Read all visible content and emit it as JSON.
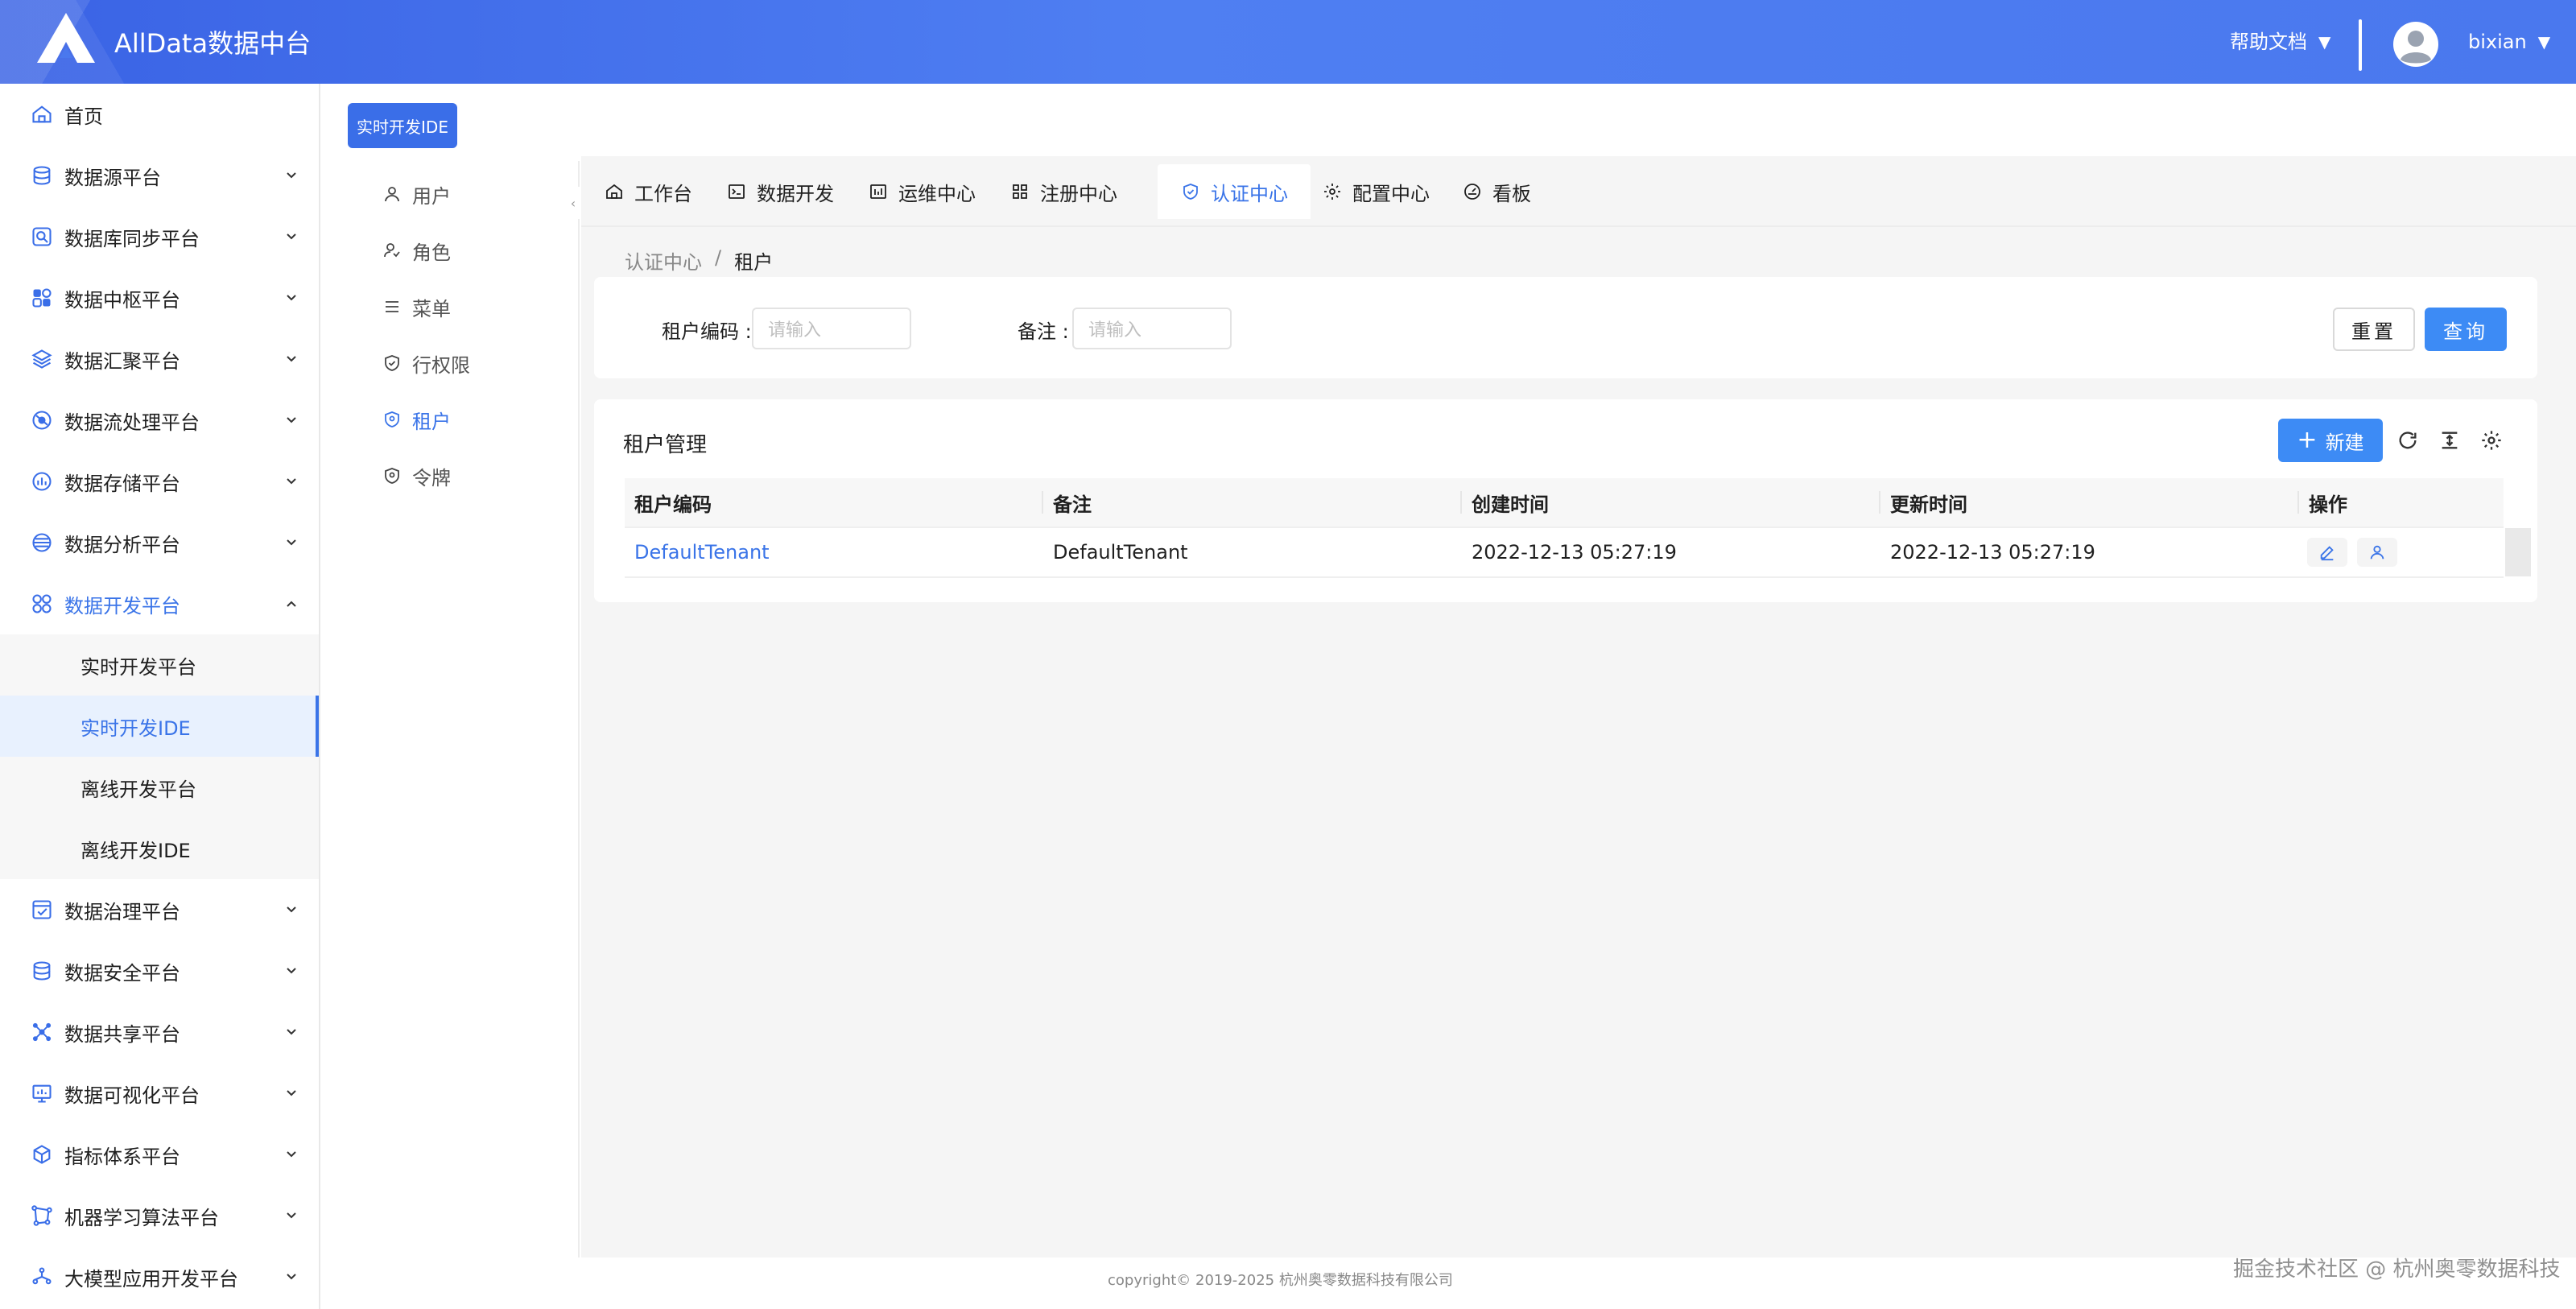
{
  "header": {
    "title": "AllData数据中台",
    "help": "帮助文档",
    "username": "bixian",
    "caret": "▼"
  },
  "sidebar": {
    "items": [
      {
        "label": "首页",
        "icon": "home-icon"
      },
      {
        "label": "数据源平台",
        "icon": "database-icon"
      },
      {
        "label": "数据库同步平台",
        "icon": "sync-icon"
      },
      {
        "label": "数据中枢平台",
        "icon": "hub-icon"
      },
      {
        "label": "数据汇聚平台",
        "icon": "layers-icon"
      },
      {
        "label": "数据流处理平台",
        "icon": "stream-icon"
      },
      {
        "label": "数据存储平台",
        "icon": "storage-icon"
      },
      {
        "label": "数据分析平台",
        "icon": "analysis-icon"
      },
      {
        "label": "数据开发平台",
        "icon": "dev-icon"
      },
      {
        "label": "数据治理平台",
        "icon": "governance-icon"
      },
      {
        "label": "数据安全平台",
        "icon": "security-icon"
      },
      {
        "label": "数据共享平台",
        "icon": "share-icon"
      },
      {
        "label": "数据可视化平台",
        "icon": "monitor-icon"
      },
      {
        "label": "指标体系平台",
        "icon": "cube-icon"
      },
      {
        "label": "机器学习算法平台",
        "icon": "ml-icon"
      },
      {
        "label": "大模型应用开发平台",
        "icon": "llm-icon"
      }
    ],
    "sub_items": [
      {
        "label": "实时开发平台"
      },
      {
        "label": "实时开发IDE"
      },
      {
        "label": "离线开发平台"
      },
      {
        "label": "离线开发IDE"
      }
    ]
  },
  "top_tag": "实时开发IDE",
  "submenu": {
    "items": [
      {
        "label": "用户"
      },
      {
        "label": "角色"
      },
      {
        "label": "菜单"
      },
      {
        "label": "行权限"
      },
      {
        "label": "租户"
      },
      {
        "label": "令牌"
      }
    ]
  },
  "tabs": [
    {
      "label": "工作台"
    },
    {
      "label": "数据开发"
    },
    {
      "label": "运维中心"
    },
    {
      "label": "注册中心"
    },
    {
      "label": "认证中心"
    },
    {
      "label": "配置中心"
    },
    {
      "label": "看板"
    }
  ],
  "breadcrumb": {
    "parent": "认证中心",
    "sep": "/",
    "current": "租户"
  },
  "filter": {
    "code_label": "租户编码 :",
    "code_placeholder": "请输入",
    "remark_label": "备注 :",
    "remark_placeholder": "请输入",
    "reset": "重置",
    "query": "查询"
  },
  "table": {
    "title": "租户管理",
    "new_label": "新建",
    "columns": [
      "租户编码",
      "备注",
      "创建时间",
      "更新时间",
      "操作"
    ],
    "rows": [
      {
        "code": "DefaultTenant",
        "remark": "DefaultTenant",
        "created": "2022-12-13 05:27:19",
        "updated": "2022-12-13 05:27:19"
      }
    ]
  },
  "footer": {
    "copyright": "copyright© 2019-2025 杭州奥零数据科技有限公司",
    "watermark": "掘金技术社区 @ 杭州奥零数据科技"
  },
  "colors": {
    "header": "#4a78ee",
    "accent": "#3a74e8",
    "primary_button": "#3d8bf5",
    "content_bg": "#f5f5f5"
  }
}
